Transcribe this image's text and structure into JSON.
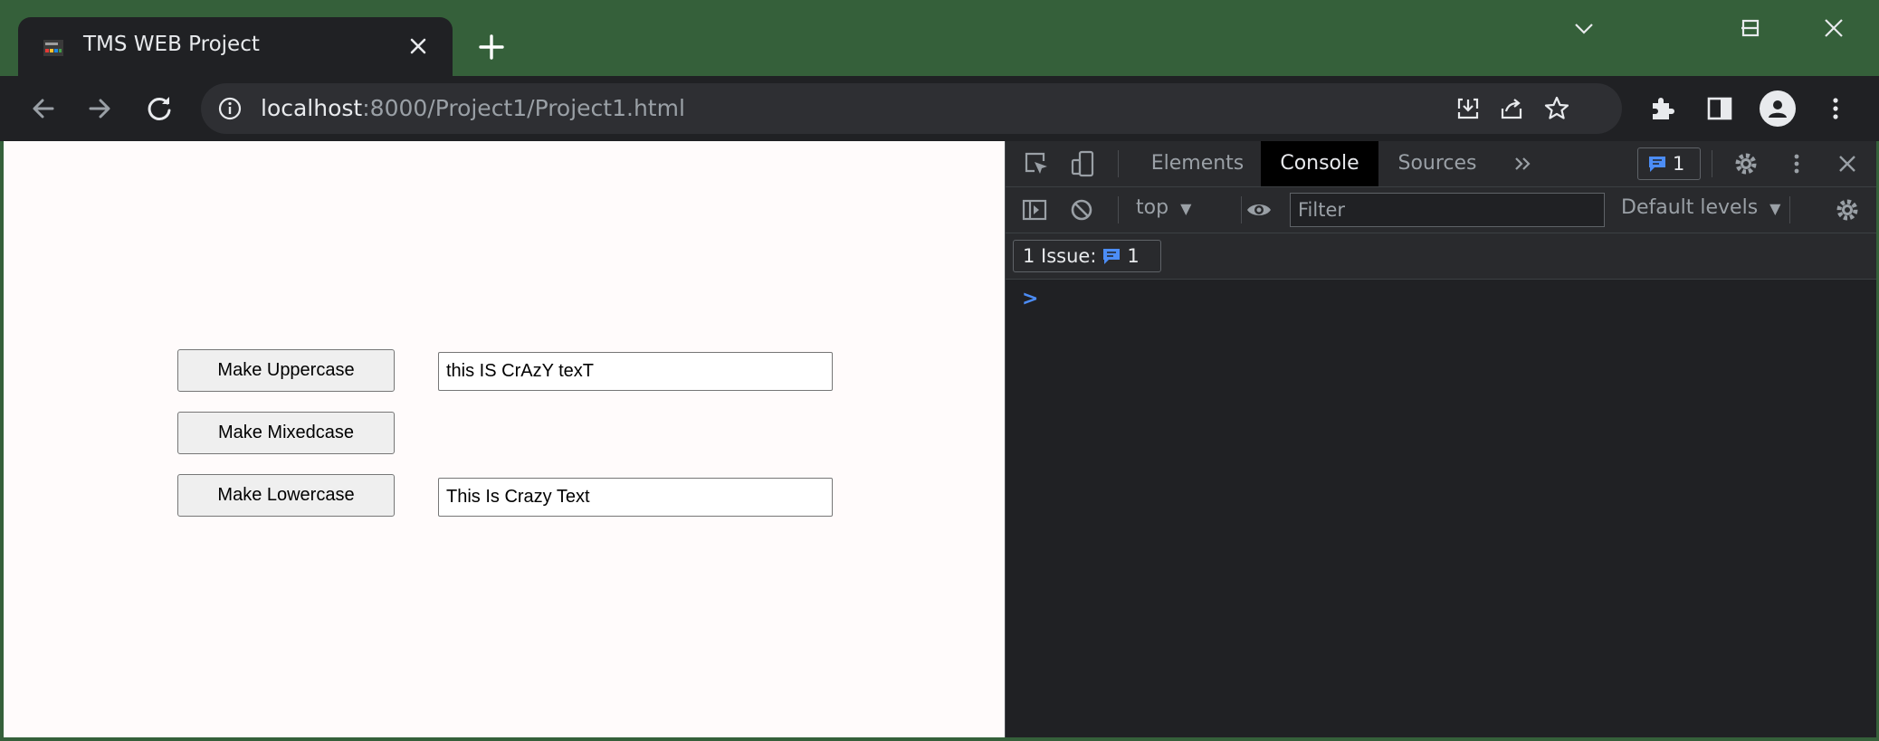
{
  "browser": {
    "tab_title": "TMS WEB Project",
    "url_host": "localhost",
    "url_rest": ":8000/Project1/Project1.html"
  },
  "page": {
    "uppercase_button": "Make Uppercase",
    "mixedcase_button": "Make Mixedcase",
    "lowercase_button": "Make Lowercase",
    "input_text": "this IS CrAzY texT",
    "output_text": "This Is Crazy Text"
  },
  "devtools": {
    "tabs": [
      "Elements",
      "Console",
      "Sources"
    ],
    "active_tab": "Console",
    "issues_count": "1",
    "context": "top",
    "filter_placeholder": "Filter",
    "levels": "Default levels",
    "issue_label": "1 Issue:",
    "issue_count": "1",
    "prompt": ">"
  },
  "colors": {
    "window_frame": "#35603a",
    "chrome_dark": "#202124",
    "devtools_accent": "#4c8df6"
  }
}
